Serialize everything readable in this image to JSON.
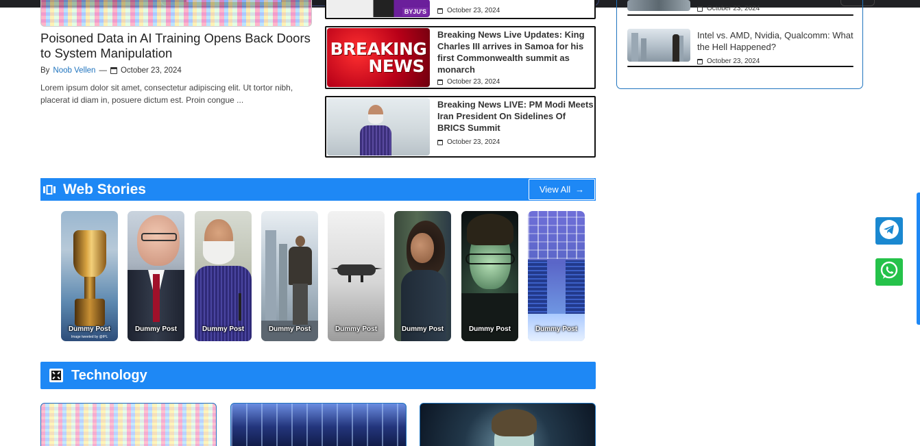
{
  "featured": {
    "title": "Poisoned Data in AI Training Opens Back Doors to System Manipulation",
    "by_label": "By",
    "author": "Noob Vellen",
    "separator": "—",
    "date": "October 23, 2024",
    "excerpt": "Lorem ipsum dolor sit amet, consectetur adipiscing elit. Ut tortor nibh, placerat id diam in, posuere dictum est. Proin congue ..."
  },
  "news_list": [
    {
      "title": "",
      "date": "October 23, 2024",
      "thumb_badge": "BYJU'S"
    },
    {
      "title": "Breaking News Live Updates: King Charles III arrives in Samoa for his first Commonwealth summit as monarch",
      "date": "October 23, 2024",
      "thumb_line1": "BREAKING",
      "thumb_line2": "NEWS"
    },
    {
      "title": "Breaking News LIVE: PM Modi Meets Iran President On Sidelines Of BRICS Summit",
      "date": "October 23, 2024"
    }
  ],
  "web_stories": {
    "heading": "Web Stories",
    "view_all": "View All",
    "view_all_arrow": "→",
    "items": [
      {
        "caption": "Dummy Post",
        "credit": "Image tweeted by @IPL"
      },
      {
        "caption": "Dummy Post"
      },
      {
        "caption": "Dummy Post"
      },
      {
        "caption": "Dummy Post"
      },
      {
        "caption": "Dummy Post"
      },
      {
        "caption": "Dummy Post"
      },
      {
        "caption": "Dummy Post"
      },
      {
        "caption": "Dummy Post"
      }
    ]
  },
  "technology": {
    "heading": "Technology"
  },
  "sidebar": {
    "items": [
      {
        "title": "",
        "date": "October 23, 2024"
      },
      {
        "title": "Intel vs. AMD, Nvidia, Qualcomm: What the Hell Happened?",
        "date": "October 23, 2024"
      }
    ]
  },
  "floating": {
    "telegram": "telegram-icon",
    "whatsapp": "whatsapp-icon"
  },
  "colors": {
    "accent": "#1e88f5",
    "link": "#1e73be",
    "telegram": "#1a88d0",
    "whatsapp": "#25c24a"
  }
}
